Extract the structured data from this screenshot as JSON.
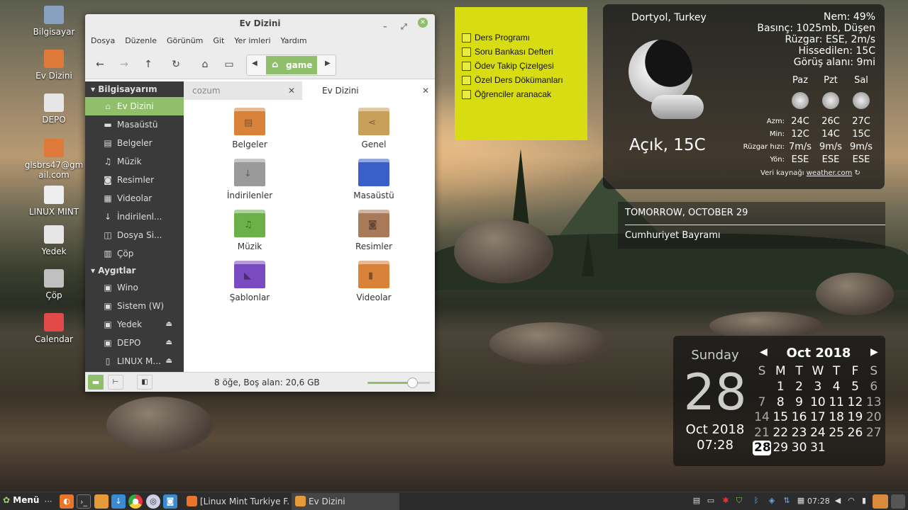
{
  "desktop": {
    "icons": [
      {
        "label": "Bilgisayar",
        "icon": "computer-icon",
        "color": "#8aa0c0"
      },
      {
        "label": "Ev Dizini",
        "icon": "home-folder-icon",
        "color": "#e07a3a"
      },
      {
        "label": "DEPO",
        "icon": "drive-icon",
        "color": "#e6e6e6"
      },
      {
        "label": "glsbrs47@gmail.com",
        "icon": "home-folder-icon",
        "color": "#e07a3a"
      },
      {
        "label": "LINUX MINT",
        "icon": "drive-icon",
        "color": "#eeeeee"
      },
      {
        "label": "Yedek",
        "icon": "drive-icon",
        "color": "#e6e6e6"
      },
      {
        "label": "Çöp",
        "icon": "trash-icon",
        "color": "#c0c0c0"
      },
      {
        "label": "Calendar",
        "icon": "calendar-icon",
        "color": "#e24a4a"
      }
    ]
  },
  "file_manager": {
    "title": "Ev Dizini",
    "menu": [
      "Dosya",
      "Düzenle",
      "Görünüm",
      "Git",
      "Yer imleri",
      "Yardım"
    ],
    "breadcrumb": "game",
    "sidebar": {
      "computer_header": "Bilgisayarım",
      "computer_items": [
        {
          "label": "Ev Dizini",
          "icon": "home-icon",
          "selected": true
        },
        {
          "label": "Masaüstü",
          "icon": "desktop-icon"
        },
        {
          "label": "Belgeler",
          "icon": "document-icon"
        },
        {
          "label": "Müzik",
          "icon": "music-icon"
        },
        {
          "label": "Resimler",
          "icon": "camera-icon"
        },
        {
          "label": "Videolar",
          "icon": "video-icon"
        },
        {
          "label": "İndirilenl...",
          "icon": "download-icon"
        },
        {
          "label": "Dosya Si...",
          "icon": "filesystem-icon"
        },
        {
          "label": "Çöp",
          "icon": "trash-icon"
        }
      ],
      "devices_header": "Aygıtlar",
      "device_items": [
        {
          "label": "Wino",
          "icon": "drive-icon"
        },
        {
          "label": "Sistem (W)",
          "icon": "drive-icon"
        },
        {
          "label": "Yedek",
          "icon": "drive-icon",
          "eject": true
        },
        {
          "label": "DEPO",
          "icon": "drive-icon",
          "eject": true
        },
        {
          "label": "LINUX M...",
          "icon": "usb-icon",
          "eject": true
        }
      ]
    },
    "tabs": [
      {
        "label": "cozum",
        "active": false
      },
      {
        "label": "Ev Dizini",
        "active": true
      }
    ],
    "folders": [
      {
        "label": "Belgeler",
        "color": "#d9823a",
        "glyph": "▤"
      },
      {
        "label": "Genel",
        "color": "#c8a05a",
        "glyph": "⋖"
      },
      {
        "label": "İndirilenler",
        "color": "#9a9a9a",
        "glyph": "↓"
      },
      {
        "label": "Masaüstü",
        "color": "#3a5fc8",
        "glyph": ""
      },
      {
        "label": "Müzik",
        "color": "#6cb04a",
        "glyph": "♫"
      },
      {
        "label": "Resimler",
        "color": "#a87a5a",
        "glyph": "◙"
      },
      {
        "label": "Şablonlar",
        "color": "#7a4ac0",
        "glyph": "◣"
      },
      {
        "label": "Videolar",
        "color": "#d9823a",
        "glyph": "▮"
      }
    ],
    "status_text": "8 öğe, Boş alan: 20,6 GB",
    "zoom_level": 0.72
  },
  "sticky_note": {
    "items": [
      "Ders Programı",
      "Soru Bankası Defteri",
      "Ödev Takip Çizelgesi",
      "Özel Ders Dökümanları",
      "Öğrenciler  aranacak"
    ]
  },
  "weather": {
    "location": "Dortyol, Turkey",
    "current": "Açık, 15C",
    "details": [
      "Nem: 49%",
      "Basınç: 1025mb, Düşen",
      "Rüzgar: ESE, 2m/s",
      "Hissedilen: 15C",
      "Görüş alanı: 9mi"
    ],
    "forecast_days": [
      "Paz",
      "Pzt",
      "Sal"
    ],
    "row_labels": [
      "Azm:",
      "Min:",
      "Rüzgar hızı:",
      "Yön:"
    ],
    "forecast": [
      [
        "24C",
        "26C",
        "27C"
      ],
      [
        "12C",
        "14C",
        "15C"
      ],
      [
        "7m/s",
        "9m/s",
        "9m/s"
      ],
      [
        "ESE",
        "ESE",
        "ESE"
      ]
    ],
    "source_label": "Veri kaynağı",
    "source_link": "weather.com"
  },
  "holiday": {
    "date": "TOMORROW, OCTOBER 29",
    "name": "Cumhuriyet Bayramı"
  },
  "calendar": {
    "weekday": "Sunday",
    "day": "28",
    "month_year": "Oct 2018",
    "time": "07:28",
    "header": "Oct 2018",
    "weekday_heads": [
      "S",
      "M",
      "T",
      "W",
      "T",
      "F",
      "S"
    ],
    "weeks": [
      [
        "",
        "1",
        "2",
        "3",
        "4",
        "5",
        "6"
      ],
      [
        "7",
        "8",
        "9",
        "10",
        "11",
        "12",
        "13"
      ],
      [
        "14",
        "15",
        "16",
        "17",
        "18",
        "19",
        "20"
      ],
      [
        "21",
        "22",
        "23",
        "24",
        "25",
        "26",
        "27"
      ],
      [
        "28",
        "29",
        "30",
        "31",
        "",
        "",
        ""
      ]
    ],
    "today": "28"
  },
  "panel": {
    "menu_label": "Menü",
    "tasks": [
      "[Linux Mint Turkiye F...",
      "Ev Dizini"
    ],
    "clock": "07:28"
  }
}
